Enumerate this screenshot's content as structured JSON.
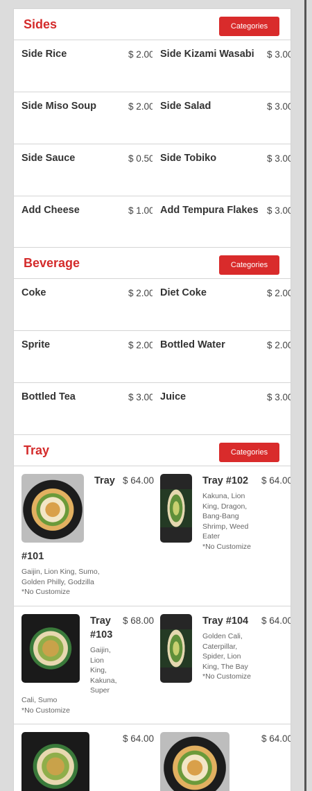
{
  "sections": {
    "sides": {
      "title": "Sides",
      "button": "Categories",
      "items": [
        {
          "name": "Side Rice",
          "price": "$ 2.00"
        },
        {
          "name": "Side Kizami Wasabi",
          "price": "$ 3.00"
        },
        {
          "name": "Side Miso Soup",
          "price": "$ 2.00"
        },
        {
          "name": "Side Salad",
          "price": "$ 3.00"
        },
        {
          "name": "Side Sauce",
          "price": "$ 0.50"
        },
        {
          "name": "Side Tobiko",
          "price": "$ 3.00"
        },
        {
          "name": "Add Cheese",
          "price": "$ 1.00"
        },
        {
          "name": "Add Tempura Flakes",
          "price": "$ 3.00"
        }
      ]
    },
    "beverage": {
      "title": "Beverage",
      "button": "Categories",
      "items": [
        {
          "name": "Coke",
          "price": "$ 2.00"
        },
        {
          "name": "Diet Coke",
          "price": "$ 2.00"
        },
        {
          "name": "Sprite",
          "price": "$ 2.00"
        },
        {
          "name": "Bottled Water",
          "price": "$ 2.00"
        },
        {
          "name": "Bottled Tea",
          "price": "$ 3.00"
        },
        {
          "name": "Juice",
          "price": "$ 3.00"
        }
      ]
    },
    "tray": {
      "title": "Tray",
      "button": "Categories",
      "items": [
        {
          "name_a": "Tray",
          "name_b": "#101",
          "price": "$ 64.00",
          "desc_a": "Gaijin, Lion King, Sumo,",
          "desc_b": "Golden Philly, Godzilla",
          "note": "*No Customize"
        },
        {
          "name": "Tray #102",
          "price": "$ 64.00",
          "desc": "Kakuna, Lion King, Dragon, Bang-Bang Shrimp, Weed Eater",
          "note": "*No Customize"
        },
        {
          "name": "Tray #103",
          "price": "$ 68.00",
          "desc_a": "Gaijin, Lion King, Kakuna, Super",
          "desc_b": "Cali, Sumo",
          "note": "*No Customize"
        },
        {
          "name": "Tray #104",
          "price": "$ 64.00",
          "desc": "Golden Cali, Caterpillar, Spider, Lion King, The Bay",
          "note": "*No Customize"
        },
        {
          "price": "$ 64.00"
        },
        {
          "price": "$ 64.00"
        }
      ]
    }
  }
}
